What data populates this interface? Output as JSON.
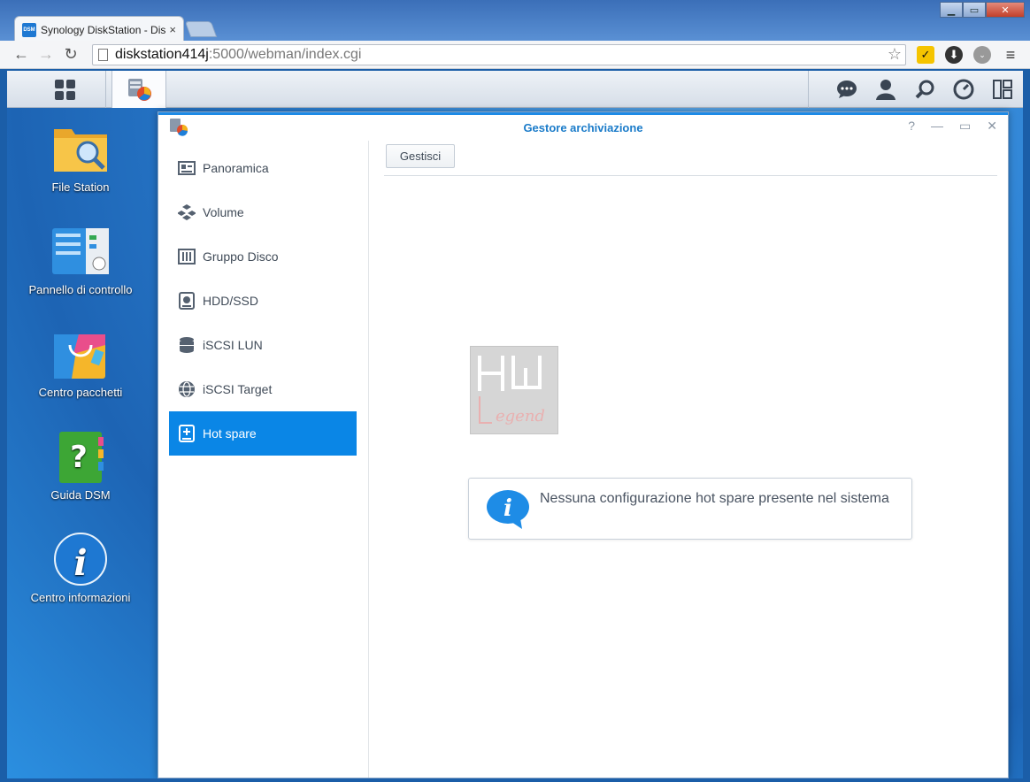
{
  "browser": {
    "tab_title": "Synology DiskStation - Dis",
    "tab_favicon_text": "DSM",
    "tab_close": "×",
    "url_host": "diskstation414j",
    "url_path": ":5000/webman/index.cgi",
    "nav": {
      "back": "←",
      "forward": "→",
      "reload": "↻"
    },
    "extensions": [
      "norton-icon",
      "download-manager-icon",
      "extension-icon",
      "menu-icon"
    ],
    "ext_badge": "off"
  },
  "taskbar": {
    "right_icons": [
      "notifications-icon",
      "user-icon",
      "search-icon",
      "widgets-icon",
      "layout-icon"
    ]
  },
  "desktop": {
    "icons": [
      {
        "label": "File Station",
        "icon": "file-station-icon"
      },
      {
        "label": "Pannello di controllo",
        "icon": "control-panel-icon"
      },
      {
        "label": "Centro pacchetti",
        "icon": "package-center-icon"
      },
      {
        "label": "Guida DSM",
        "icon": "help-icon"
      },
      {
        "label": "Centro informazioni",
        "icon": "info-center-icon"
      }
    ]
  },
  "window": {
    "title": "Gestore archiviazione",
    "controls": {
      "help": "?",
      "minimize": "—",
      "maximize": "▭",
      "close": "✕"
    },
    "sidebar": [
      {
        "label": "Panoramica",
        "icon": "overview-icon"
      },
      {
        "label": "Volume",
        "icon": "volume-icon"
      },
      {
        "label": "Gruppo Disco",
        "icon": "disk-group-icon"
      },
      {
        "label": "HDD/SSD",
        "icon": "hdd-icon"
      },
      {
        "label": "iSCSI LUN",
        "icon": "iscsi-lun-icon"
      },
      {
        "label": "iSCSI Target",
        "icon": "iscsi-target-icon"
      },
      {
        "label": "Hot spare",
        "icon": "hot-spare-icon",
        "active": true
      }
    ],
    "manage_button": "Gestisci",
    "info_message": "Nessuna configurazione hot spare presente nel sistema",
    "watermark_text": "HW Legend"
  },
  "colors": {
    "accent": "#0a86e6",
    "title_blue": "#1a7bc9"
  }
}
